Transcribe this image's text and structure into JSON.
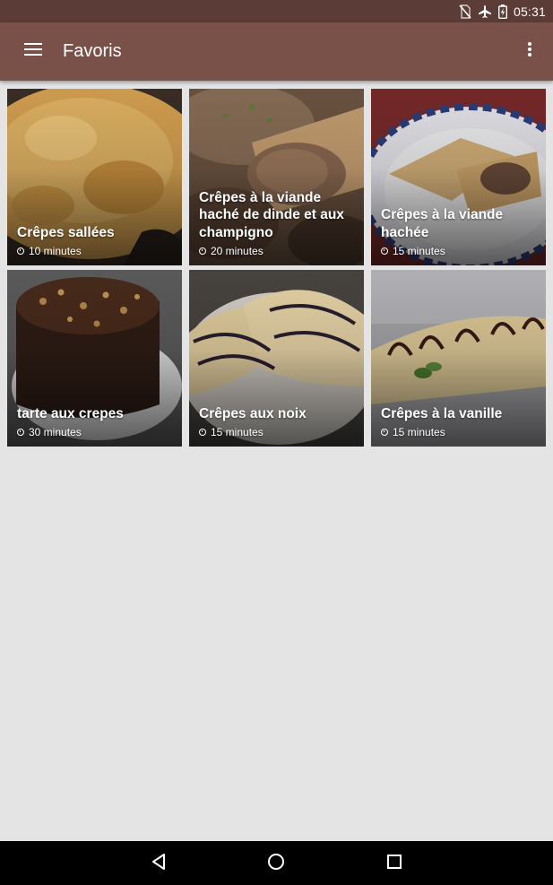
{
  "status_bar": {
    "time": "05:31",
    "icons": [
      "no-sim-icon",
      "airplane-icon",
      "battery-charging-icon"
    ]
  },
  "app_bar": {
    "title": "Favoris",
    "left_icon": "menu-icon",
    "right_icon": "more-vert-icon"
  },
  "recipes": [
    {
      "title": "Crêpes sallées",
      "time": "10 minutes"
    },
    {
      "title": "Crêpes à la viande haché de dinde et aux champigno",
      "time": "20 minutes"
    },
    {
      "title": "Crêpes à la viande hachée",
      "time": "15 minutes"
    },
    {
      "title": "tarte aux crepes",
      "time": "30 minutes"
    },
    {
      "title": "Crêpes aux noix",
      "time": "15 minutes"
    },
    {
      "title": "Crêpes à la vanille",
      "time": "15 minutes"
    }
  ],
  "nav_bar": {
    "icons": [
      "back-icon",
      "home-icon",
      "recents-icon"
    ]
  },
  "colors": {
    "status_bar": "#5b3c37",
    "app_bar": "#7a5149",
    "background": "#e4e4e4",
    "nav_bar": "#000000"
  }
}
